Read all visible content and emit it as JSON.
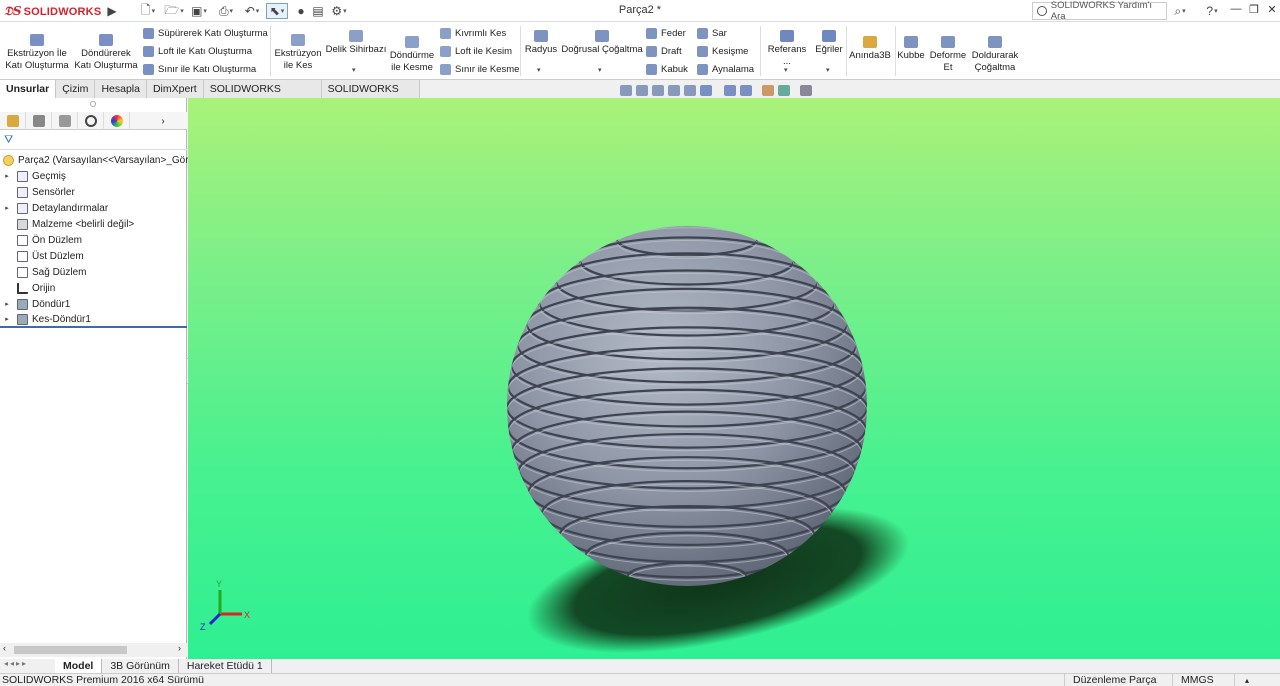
{
  "app": {
    "logo_text": "SOLIDWORKS",
    "document_title": "Parça2 *"
  },
  "help": {
    "search_placeholder": "SOLIDWORKS Yardım'ı Ara",
    "question_mark": "?"
  },
  "command_manager": {
    "ekstruzyon": "Ekstrüzyon İle Katı Oluşturma",
    "dondurerek": "Döndürerek Katı Oluşturma",
    "supurerek": "Süpürerek Katı Oluşturma",
    "loft_kati": "Loft ile Katı Oluşturma",
    "sinir_kati": "Sınır ile Katı Oluşturma",
    "ekstruzyon_kes": "Ekstrüzyon ile Kes",
    "delik": "Delik Sihirbazı",
    "dondurme_kesme": "Döndürme ile Kesme",
    "kivrimli_kes": "Kıvrımlı Kes",
    "loft_kesim": "Loft ile Kesim",
    "sinir_kesme": "Sınır ile Kesme",
    "radyus": "Radyus",
    "dogrusal": "Doğrusal Çoğaltma",
    "feder": "Feder",
    "draft": "Draft",
    "kabuk": "Kabuk",
    "sar": "Sar",
    "kesisme": "Kesişme",
    "aynalama": "Aynalama",
    "referans": "Referans ...",
    "egriler": "Eğriler",
    "aninda3b": "Anında3B",
    "kubbe": "Kubbe",
    "deforme": "Deforme Et",
    "doldurarak": "Doldurarak Çoğaltma"
  },
  "tabs": [
    "Unsurlar",
    "Çizim",
    "Hesapla",
    "DimXpert",
    "SOLIDWORKS Eklentileri",
    "SOLIDWORKS MBD"
  ],
  "feature_tree": {
    "root": "Parça2  (Varsayılan<<Varsayılan>_Görün",
    "items": [
      "Geçmiş",
      "Sensörler",
      "Detaylandırmalar",
      "Malzeme <belirli değil>",
      "Ön Düzlem",
      "Üst Düzlem",
      "Sağ Düzlem",
      "Orijin",
      "Döndür1",
      "Kes-Döndür1"
    ]
  },
  "triad": {
    "x": "X",
    "y": "Y",
    "z": "Z"
  },
  "bottom_tabs": [
    "Model",
    "3B Görünüm",
    "Hareket Etüdü 1"
  ],
  "status": {
    "left": "SOLIDWORKS Premium 2016 x64 Sürümü",
    "mode": "Düzenleme Parça",
    "units": "MMGS"
  },
  "colors": {
    "logo_red": "#d5232b",
    "viewport_top": "#a9f279",
    "viewport_bottom": "#2ef093",
    "model_gray": "#8e96a6"
  }
}
